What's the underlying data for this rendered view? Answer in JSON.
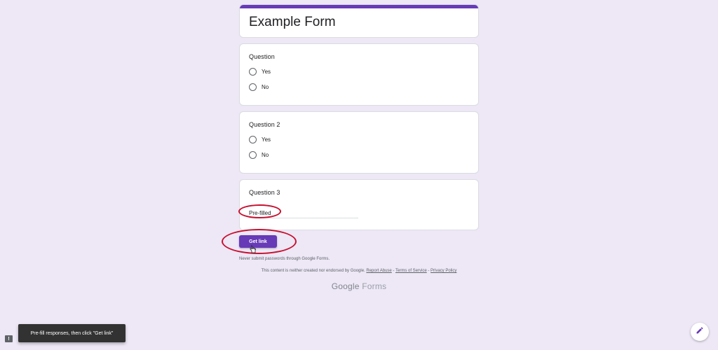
{
  "form": {
    "title": "Example Form",
    "questions": [
      {
        "title": "Question",
        "options": [
          "Yes",
          "No"
        ]
      },
      {
        "title": "Question 2",
        "options": [
          "Yes",
          "No"
        ]
      },
      {
        "title": "Question 3",
        "answer": "Pre-filled"
      }
    ]
  },
  "actions": {
    "get_link_label": "Get link"
  },
  "footer": {
    "password_warning": "Never submit passwords through Google Forms.",
    "disclaimer_prefix": "This content is neither created nor endorsed by Google.",
    "report_abuse": "Report Abuse",
    "sep1": " - ",
    "terms": "Terms of Service",
    "sep2": " - ",
    "privacy": "Privacy Policy",
    "brand_google": "Google",
    "brand_forms": "Forms"
  },
  "toast": {
    "message": "Pre-fill responses, then click \"Get link\""
  },
  "icons": {
    "feedback": "report-icon",
    "edit": "pencil-icon",
    "cursor": "hand-pointer-icon"
  },
  "colors": {
    "accent": "#673ab7",
    "background": "#ede7f6",
    "highlight": "#c8102e"
  }
}
